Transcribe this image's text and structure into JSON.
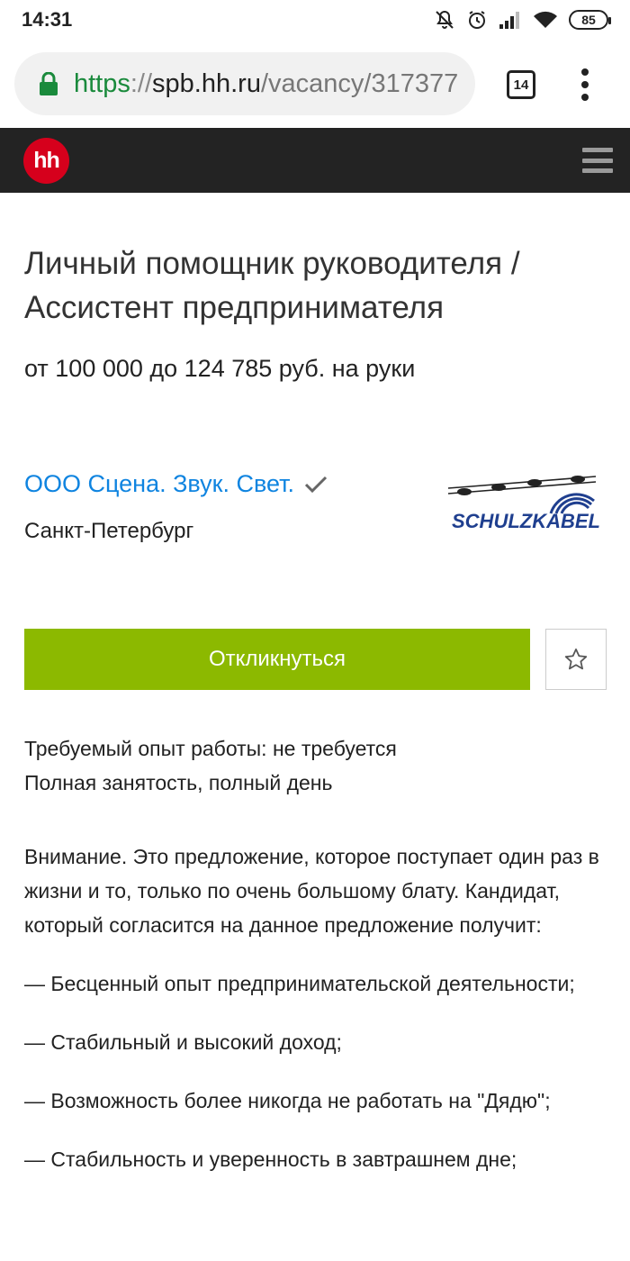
{
  "status_bar": {
    "time": "14:31",
    "icons": [
      "mute-icon",
      "alarm-icon",
      "signal-icon",
      "wifi-icon",
      "battery-icon"
    ],
    "battery": "85"
  },
  "browser": {
    "url_scheme": "https",
    "url_sep": "://",
    "url_host": "spb.hh.ru",
    "url_path": "/vacancy/317377",
    "tabs_count": "14"
  },
  "header": {
    "logo_text": "hh",
    "brand_color": "#d6001c"
  },
  "vacancy": {
    "title_line1": "Личный помощник руководителя /",
    "title_line2": "Ассистент предпринимателя",
    "salary": "от 100 000 до 124 785 руб. на руки",
    "company": "ООО Сцена. Звук. Свет.",
    "city": "Санкт-Петербург",
    "company_logo_text": "SCHULZKABEL",
    "apply_label": "Откликнуться",
    "experience": "Требуемый опыт работы: не требуется",
    "employment": "Полная занятость, полный день",
    "description": [
      "Внимание. Это предложение, которое поступает один раз в жизни и то, только по очень большому блату. Кандидат, который согласится на данное предложение получит:",
      "— Бесценный опыт предпринимательской деятельности;",
      "— Стабильный и высокий доход;",
      "— Возможность более никогда не работать на \"Дядю\";",
      "— Стабильность и уверенность в завтрашнем дне;"
    ]
  },
  "colors": {
    "apply_button": "#8cb900",
    "link": "#0f84e0",
    "header_bg": "#232323",
    "lock": "#1a8a3c"
  }
}
